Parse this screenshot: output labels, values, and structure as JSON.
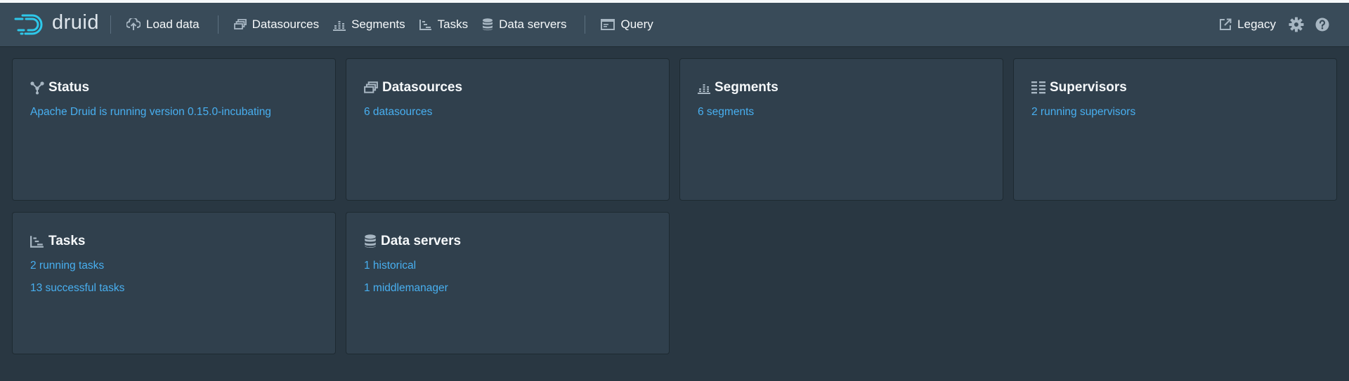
{
  "app": {
    "logo_text": "druid"
  },
  "nav": {
    "load_data": "Load data",
    "datasources": "Datasources",
    "segments": "Segments",
    "tasks": "Tasks",
    "data_servers": "Data servers",
    "query": "Query",
    "legacy": "Legacy"
  },
  "cards": {
    "status": {
      "title": "Status",
      "lines": [
        "Apache Druid is running version 0.15.0-incubating"
      ]
    },
    "datasources": {
      "title": "Datasources",
      "lines": [
        "6 datasources"
      ]
    },
    "segments": {
      "title": "Segments",
      "lines": [
        "6 segments"
      ]
    },
    "supervisors": {
      "title": "Supervisors",
      "lines": [
        "2 running supervisors"
      ]
    },
    "tasks": {
      "title": "Tasks",
      "lines": [
        "2 running tasks",
        "13 successful tasks"
      ]
    },
    "data_servers": {
      "title": "Data servers",
      "lines": [
        "1 historical",
        "1 middlemanager"
      ]
    }
  },
  "colors": {
    "background": "#293742",
    "navbar": "#394b59",
    "card": "#30404d",
    "link": "#48aff0",
    "logo_accent": "#2ec8ea",
    "text": "#f5f8fa"
  }
}
